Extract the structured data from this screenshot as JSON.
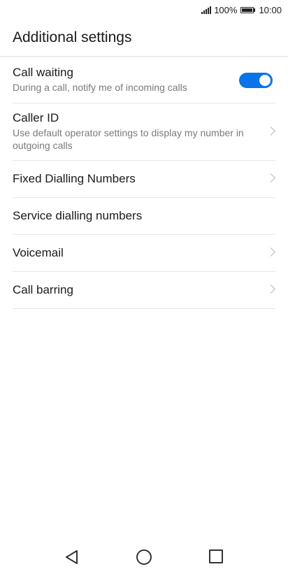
{
  "status_bar": {
    "battery_percent": "100%",
    "time": "10:00",
    "icons": [
      "signal-icon",
      "battery-icon"
    ]
  },
  "header": {
    "title": "Additional settings"
  },
  "settings": [
    {
      "title": "Call waiting",
      "subtitle": "During a call, notify me of incoming calls",
      "control": "toggle",
      "toggle_on": true
    },
    {
      "title": "Caller ID",
      "subtitle": "Use default operator settings to display my number in outgoing calls",
      "control": "chevron"
    },
    {
      "title": "Fixed Dialling Numbers",
      "control": "chevron"
    },
    {
      "title": "Service dialling numbers",
      "control": "none"
    },
    {
      "title": "Voicemail",
      "control": "chevron"
    },
    {
      "title": "Call barring",
      "control": "chevron"
    }
  ],
  "nav_bar": {
    "icons": [
      "back-icon",
      "home-icon",
      "recents-icon"
    ]
  },
  "colors": {
    "accent": "#0a73e8",
    "divider": "#e6e6e6",
    "subtitle": "#7a7a7a"
  }
}
